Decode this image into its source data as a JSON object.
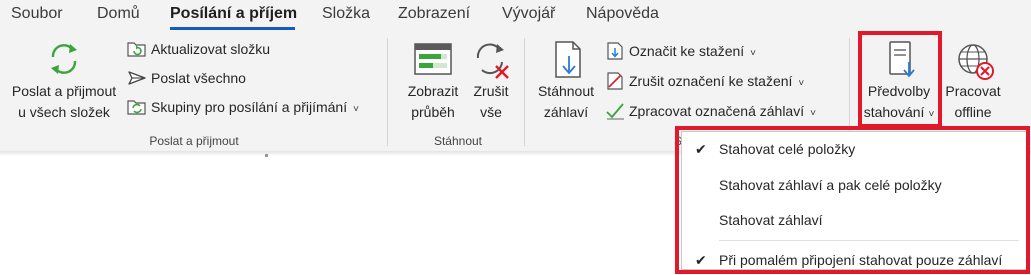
{
  "tabs": [
    {
      "label": "Soubor"
    },
    {
      "label": "Domů"
    },
    {
      "label": "Posílání a příjem",
      "active": true
    },
    {
      "label": "Složka"
    },
    {
      "label": "Zobrazení"
    },
    {
      "label": "Vývojář"
    },
    {
      "label": "Nápověda"
    }
  ],
  "ribbon": {
    "groups": {
      "send_receive": {
        "label": "Poslat a přijmout",
        "big_button": {
          "line1": "Poslat a přijmout",
          "line2": "u všech složek",
          "icon": "sync-icon"
        },
        "small_buttons": [
          {
            "label": "Aktualizovat složku",
            "icon": "folder-refresh-icon"
          },
          {
            "label": "Poslat všechno",
            "icon": "send-icon"
          },
          {
            "label": "Skupiny pro posílání a přijímání",
            "icon": "folder-sync-icon",
            "chevron": "˅"
          }
        ]
      },
      "download": {
        "label": "Stáhnout",
        "show_progress": {
          "line1": "Zobrazit",
          "line2": "průběh",
          "icon": "progress-icon"
        },
        "cancel_all": {
          "line1": "Zrušit",
          "line2": "vše",
          "icon": "cancel-sync-icon"
        }
      },
      "server": {
        "label": "S",
        "download_headers": {
          "line1": "Stáhnout",
          "line2": "záhlaví",
          "icon": "download-headers-icon"
        },
        "small_buttons": [
          {
            "label": "Označit ke stažení",
            "icon": "mark-download-icon",
            "chevron": "˅"
          },
          {
            "label": "Zrušit označení ke stažení",
            "icon": "unmark-download-icon",
            "chevron": "˅"
          },
          {
            "label": "Zpracovat označená záhlaví",
            "icon": "process-headers-icon",
            "chevron": "˅"
          }
        ]
      },
      "preferences": {
        "download_prefs": {
          "line1": "Předvolby",
          "line2": "stahování",
          "chevron": "˅",
          "icon": "download-preferences-icon"
        },
        "work_offline": {
          "line1": "Pracovat",
          "line2": "offline",
          "icon": "globe-offline-icon"
        }
      }
    }
  },
  "dropdown": {
    "items": [
      {
        "label": "Stahovat celé položky",
        "checked": true,
        "check": "✔"
      },
      {
        "label": "Stahovat záhlaví a pak celé položky",
        "checked": false,
        "check": ""
      },
      {
        "label": "Stahovat záhlaví",
        "checked": false,
        "check": ""
      },
      {
        "label": "Při pomalém připojení stahovat pouze záhlaví",
        "checked": true,
        "check": "✔"
      }
    ]
  },
  "colors": {
    "highlight": "#e11a2b",
    "accent": "#185abd",
    "green": "#3aa53a",
    "ribbon_bg": "#f3f3f3"
  }
}
